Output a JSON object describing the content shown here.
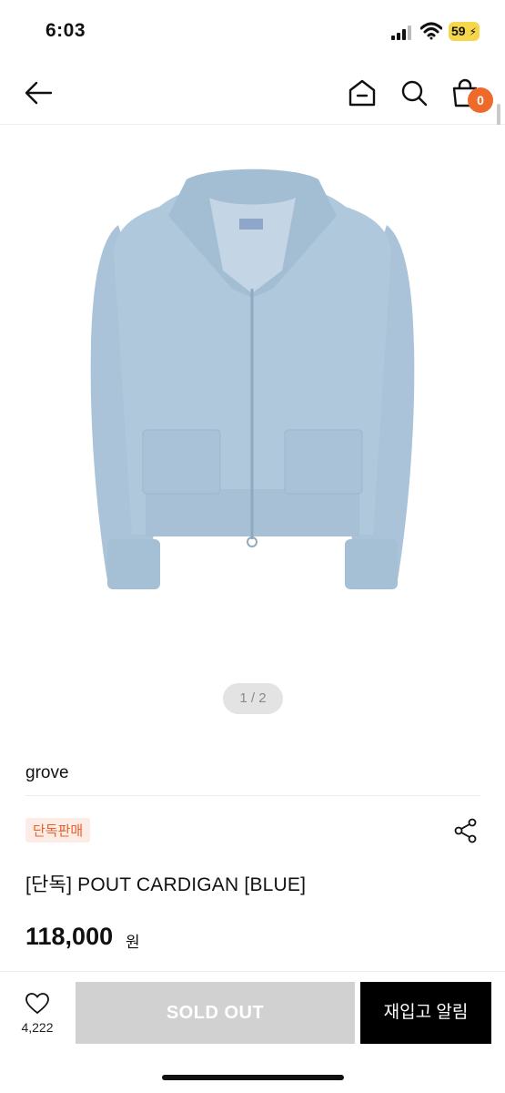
{
  "status": {
    "time": "6:03",
    "battery": "59"
  },
  "nav": {
    "cart_count": "0"
  },
  "gallery": {
    "counter": "1 / 2"
  },
  "product": {
    "brand": "grove",
    "badge": "단독판매",
    "title": "[단독] POUT CARDIGAN [BLUE]",
    "price": "118,000",
    "price_unit": "원",
    "garment_color": "#aac3d9"
  },
  "actions": {
    "like_count": "4,222",
    "sold_out_label": "SOLD OUT",
    "restock_label": "재입고 알림"
  },
  "colors": {
    "accent": "#ee6a2b",
    "badge_bg": "#fdece5"
  }
}
